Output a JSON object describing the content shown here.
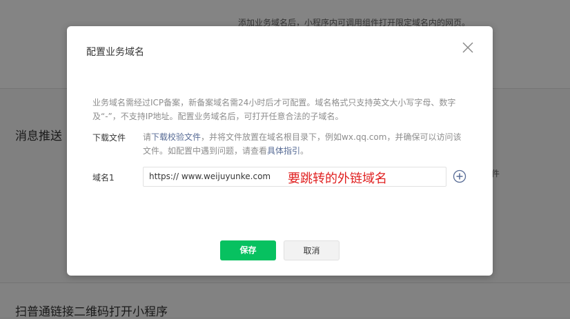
{
  "background": {
    "top_hint": "添加业务域名后，小程序内可调用组件打开限定域名内的网页。",
    "section_message_push": "消息推送",
    "side_char": "件",
    "section_qrcode": "扫普通链接二维码打开小程序"
  },
  "modal": {
    "title": "配置业务域名",
    "close_icon": "close-icon",
    "description": "业务域名需经过ICP备案，新备案域名需24小时后才可配置。域名格式只支持英文大小写字母、数字及“-”，不支持IP地址。配置业务域名后，可打开任意合法的子域名。",
    "download": {
      "label": "下载文件",
      "text_before": "请",
      "link_download": "下载校验文件",
      "text_middle": "，并将文件放置在域名根目录下，例如wx.qq.com，并确保可以访问该文件。如配置中遇到问题，请查看",
      "link_guide": "具体指引",
      "text_after": "。"
    },
    "domain": {
      "label": "域名1",
      "value": "https:// www.weijuyunke.com",
      "annotation": "要跳转的外链域名",
      "add_icon": "plus-circle-icon"
    },
    "buttons": {
      "save": "保存",
      "cancel": "取消"
    }
  },
  "colors": {
    "primary": "#07c160",
    "link": "#576b95",
    "annotation": "#e02020",
    "overlay": "#808080"
  }
}
